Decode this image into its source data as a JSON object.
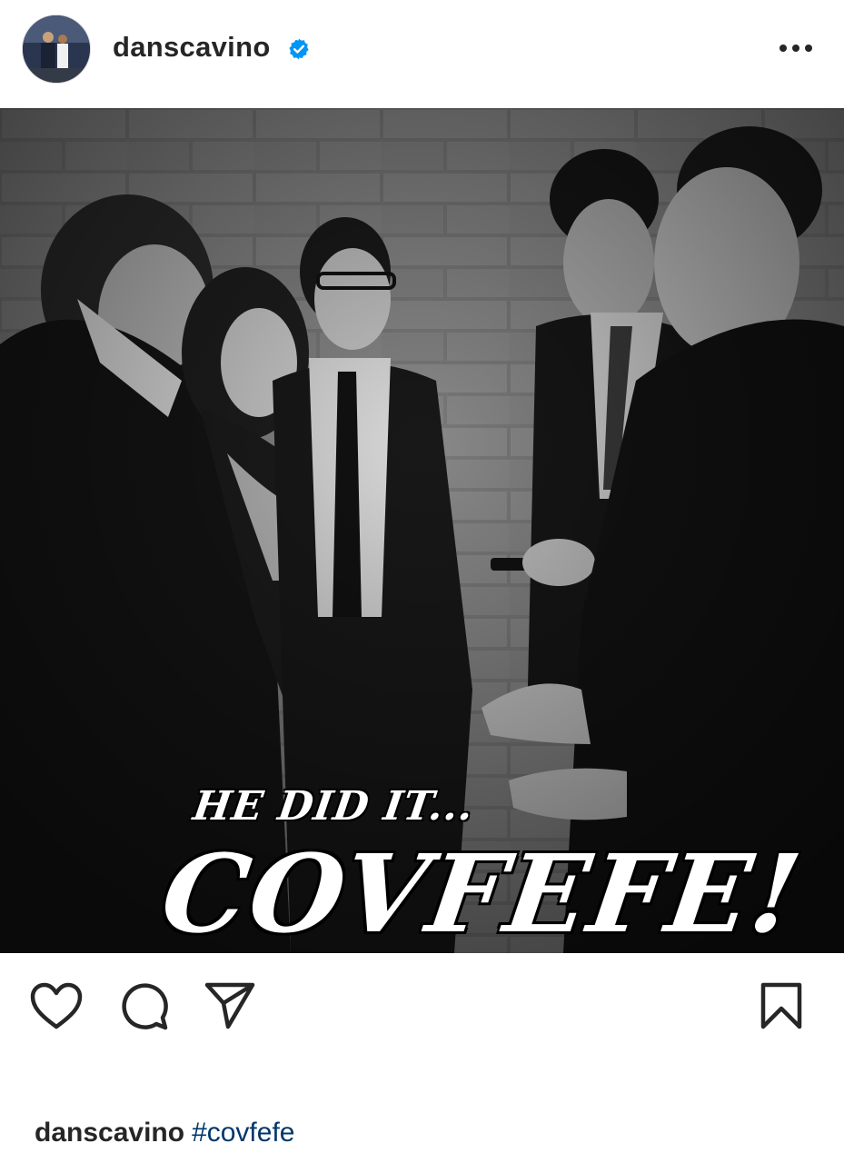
{
  "post": {
    "username": "danscavino",
    "image_text_line1": "HE DID IT...",
    "image_text_line2": "COVFEFE!"
  },
  "caption": {
    "username": "danscavino",
    "hashtag": "#covfefe"
  },
  "icons": {
    "avatar": "profile-avatar",
    "verified": "verified-badge-icon",
    "more": "more-options-icon",
    "like": "heart-icon",
    "comment": "comment-icon",
    "share": "send-icon",
    "save": "bookmark-icon"
  },
  "colors": {
    "verified_blue": "#0095f6",
    "hashtag": "#00376b",
    "text": "#262626"
  }
}
